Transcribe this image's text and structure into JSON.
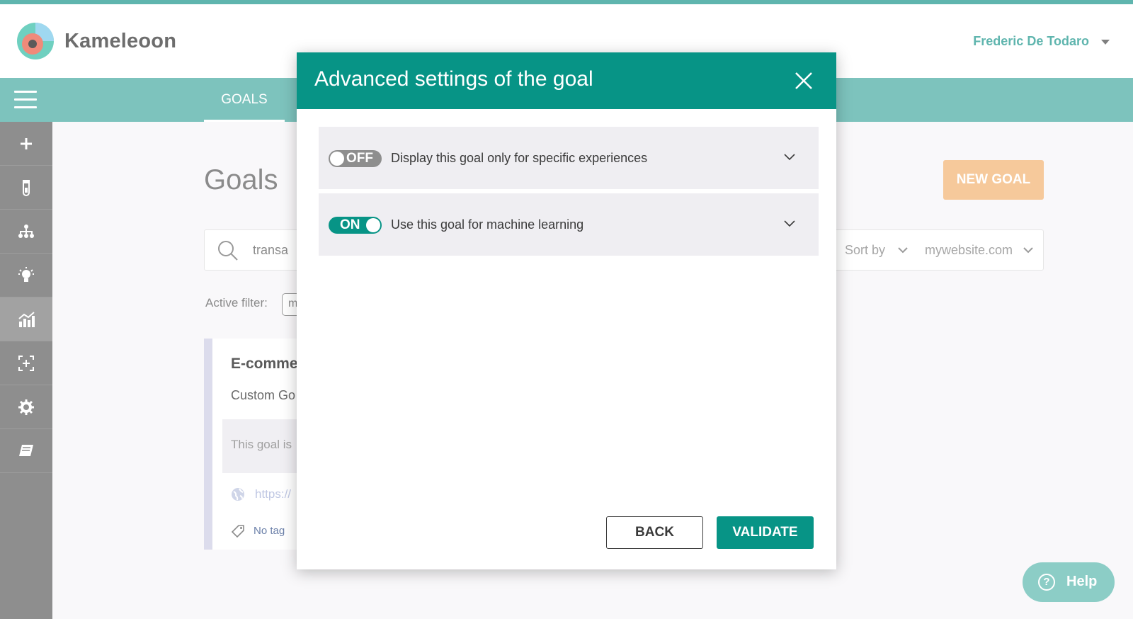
{
  "app": {
    "brand": "Kameleoon",
    "user_name": "Frederic De Todaro",
    "accent_color": "#079486",
    "navbar_color": "#7dc3bd"
  },
  "navbar": {
    "active_tab": "GOALS"
  },
  "sidebar": {
    "items": [
      {
        "icon": "plus-icon"
      },
      {
        "icon": "flask-icon"
      },
      {
        "icon": "hierarchy-icon"
      },
      {
        "icon": "lightbulb-icon"
      },
      {
        "icon": "analytics-icon",
        "active": true
      },
      {
        "icon": "focus-add-icon"
      },
      {
        "icon": "gear-icon"
      },
      {
        "icon": "book-icon"
      }
    ]
  },
  "page": {
    "title": "Goals",
    "new_goal_label": "NEW GOAL",
    "search_value": "transa",
    "sort_label": "Sort by",
    "website_value": "mywebsite.com",
    "active_filter_label": "Active filter:",
    "filter_chip_text": "m"
  },
  "goal_card": {
    "title": "E-comme",
    "type": "Custom Go",
    "description": "This goal is",
    "url": "https://",
    "tag": "No tag"
  },
  "help": {
    "label": "Help",
    "glyph": "?"
  },
  "modal": {
    "title": "Advanced settings of the goal",
    "settings": [
      {
        "state": "OFF",
        "label": "Display this goal only for specific experiences"
      },
      {
        "state": "ON",
        "label": "Use this goal for machine learning"
      }
    ],
    "back_label": "BACK",
    "validate_label": "VALIDATE"
  }
}
